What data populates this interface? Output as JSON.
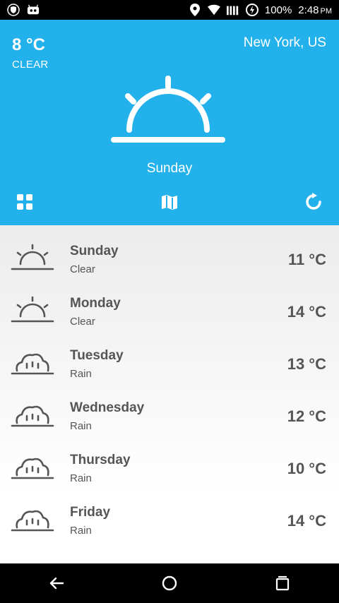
{
  "status_bar": {
    "battery": "100%",
    "time": "2:48",
    "ampm": "PM"
  },
  "current": {
    "temperature": "8 °C",
    "condition": "CLEAR",
    "location": "New York, US",
    "day": "Sunday",
    "icon": "sunrise-icon"
  },
  "colors": {
    "hero_bg": "#22b1eb",
    "text_gray": "#555555"
  },
  "forecast": [
    {
      "day": "Sunday",
      "desc": "Clear",
      "temp": "11 °C",
      "icon": "sunrise-icon"
    },
    {
      "day": "Monday",
      "desc": "Clear",
      "temp": "14 °C",
      "icon": "sunrise-icon"
    },
    {
      "day": "Tuesday",
      "desc": "Rain",
      "temp": "13 °C",
      "icon": "rain-cloud-icon"
    },
    {
      "day": "Wednesday",
      "desc": "Rain",
      "temp": "12 °C",
      "icon": "rain-cloud-icon"
    },
    {
      "day": "Thursday",
      "desc": "Rain",
      "temp": "10 °C",
      "icon": "rain-cloud-icon"
    },
    {
      "day": "Friday",
      "desc": "Rain",
      "temp": "14 °C",
      "icon": "rain-cloud-icon"
    }
  ]
}
